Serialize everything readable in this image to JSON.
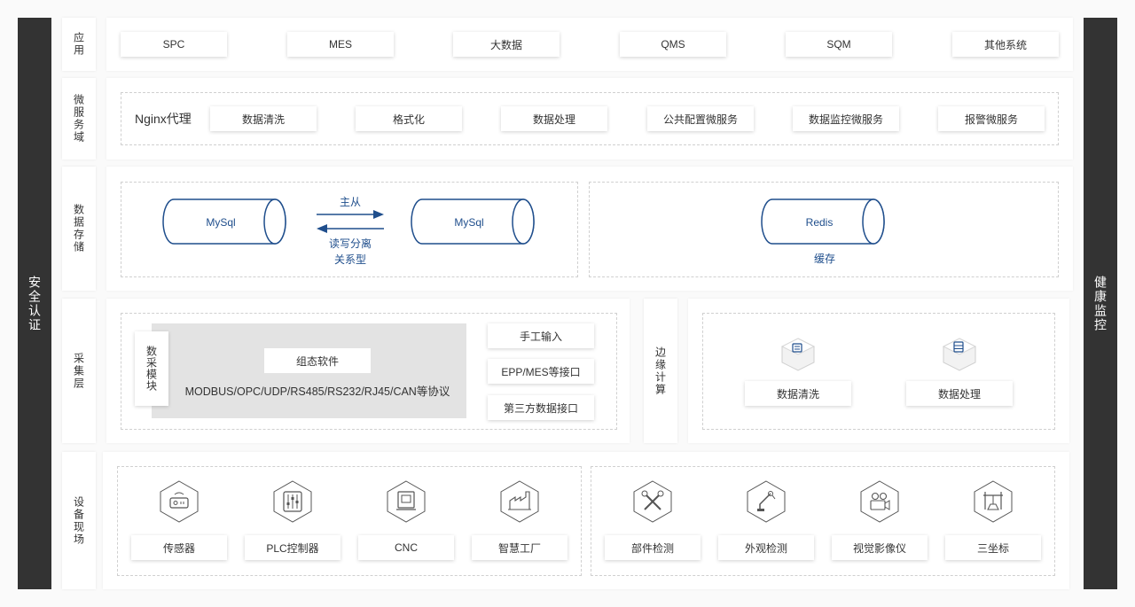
{
  "sidebars": {
    "left": "安全认证",
    "right": "健康监控"
  },
  "layers": {
    "app": {
      "label": "应用",
      "items": [
        "SPC",
        "MES",
        "大数据",
        "QMS",
        "SQM",
        "其他系统"
      ]
    },
    "micro": {
      "label": "微服务域",
      "nginx": "Nginx代理",
      "items": [
        "数据清洗",
        "格式化",
        "数据处理",
        "公共配置微服务",
        "数据监控微服务",
        "报警微服务"
      ]
    },
    "storage": {
      "label": "数据存储",
      "db1": "MySql",
      "db2": "MySql",
      "arrow_top": "主从",
      "arrow_bottom1": "读写分离",
      "arrow_bottom2": "关系型",
      "redis": "Redis",
      "redis_caption": "缓存"
    },
    "collect": {
      "label": "采集层",
      "module_label": "数采模块",
      "config_soft": "组态软件",
      "protocols": "MODBUS/OPC/UDP/RS485/RS232/RJ45/CAN等协议",
      "interfaces": [
        "手工输入",
        "EPP/MES等接口",
        "第三方数据接口"
      ],
      "edge_label": "边缘计算",
      "edge_items": [
        "数据清洗",
        "数据处理"
      ]
    },
    "device": {
      "label": "设备现场",
      "items": [
        "传感器",
        "PLC控制器",
        "CNC",
        "智慧工厂",
        "部件检测",
        "外观检测",
        "视觉影像仪",
        "三坐标"
      ]
    }
  },
  "colors": {
    "sidebar": "#333333",
    "accent": "#1f4e8c"
  }
}
